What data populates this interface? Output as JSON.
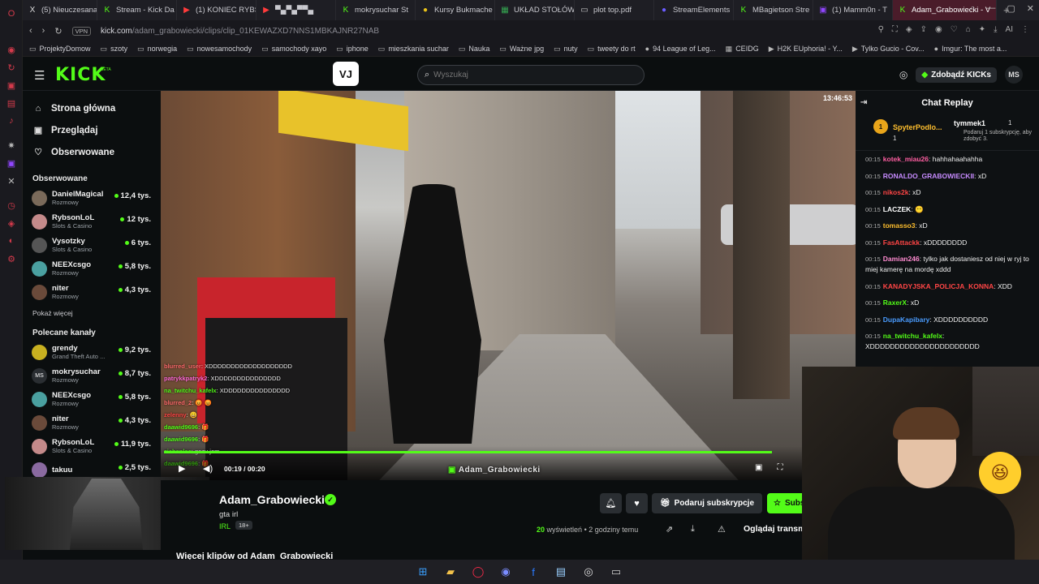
{
  "tabs": [
    {
      "label": "(5) Nieuczesana",
      "fav": "X",
      "color": "#ddd"
    },
    {
      "label": "Stream - Kick Da",
      "fav": "K",
      "color": "#53fc18"
    },
    {
      "label": "(1) KONIEC RYBS",
      "fav": "▶",
      "color": "#ff3b3b"
    },
    {
      "label": "▀▄▀▄▀▀▄",
      "fav": "▶",
      "color": "#ff3b3b"
    },
    {
      "label": "mokrysuchar St",
      "fav": "K",
      "color": "#53fc18"
    },
    {
      "label": "Kursy Bukmache",
      "fav": "●",
      "color": "#e9c21a"
    },
    {
      "label": "UKŁAD STOŁÓW",
      "fav": "▦",
      "color": "#36a852"
    },
    {
      "label": "plot top.pdf",
      "fav": "▭",
      "color": "#ccc"
    },
    {
      "label": "StreamElements",
      "fav": "●",
      "color": "#6a5cff"
    },
    {
      "label": "MBagietson Stre",
      "fav": "K",
      "color": "#53fc18"
    },
    {
      "label": "(1) Mamm0n - T",
      "fav": "▣",
      "color": "#9146ff"
    },
    {
      "label": "Adam_Grabowiecki - V",
      "fav": "K",
      "color": "#53fc18",
      "active": true
    }
  ],
  "browser": {
    "vpn": "VPN",
    "url_host": "kick.com",
    "url_path": "/adam_grabowiecki/clips/clip_01KEWAZXD7NNS1MBKAJNR27NAB"
  },
  "bookmarks": [
    {
      "label": "ProjektyDomow",
      "icon": "▭"
    },
    {
      "label": "szoty",
      "icon": "▭"
    },
    {
      "label": "norwegia",
      "icon": "▭"
    },
    {
      "label": "nowesamochody",
      "icon": "▭"
    },
    {
      "label": "samochody xayo",
      "icon": "▭"
    },
    {
      "label": "iphone",
      "icon": "▭"
    },
    {
      "label": "mieszkania suchar",
      "icon": "▭"
    },
    {
      "label": "Nauka",
      "icon": "▭"
    },
    {
      "label": "Ważne jpg",
      "icon": "▭"
    },
    {
      "label": "nuty",
      "icon": "▭"
    },
    {
      "label": "tweety do rt",
      "icon": "▭"
    },
    {
      "label": "94 League of Leg...",
      "icon": "●"
    },
    {
      "label": "CEIDG",
      "icon": "▦"
    },
    {
      "label": "H2K EUphoria! - Y...",
      "icon": "▶"
    },
    {
      "label": "Tylko Gucio - Cov...",
      "icon": "▶"
    },
    {
      "label": "Imgur: The most a...",
      "icon": "●"
    }
  ],
  "header": {
    "logo": "KICK",
    "beta": "BETA",
    "vj": "VJ",
    "search_placeholder": "Wyszukaj",
    "kicks_label": "Zdobądź KICKs",
    "avatar": "MS"
  },
  "nav": [
    {
      "label": "Strona główna",
      "icon": "⌂"
    },
    {
      "label": "Przeglądaj",
      "icon": "▣"
    },
    {
      "label": "Obserwowane",
      "icon": "♡"
    }
  ],
  "followed_heading": "Obserwowane",
  "followed": [
    {
      "name": "DanielMagical",
      "cat": "Rozmowy",
      "viewers": "12,4 tys.",
      "color": "#7a6a5a"
    },
    {
      "name": "RybsonLoL",
      "cat": "Slots & Casino",
      "viewers": "12 tys.",
      "color": "#c48a8a"
    },
    {
      "name": "Vysotzky",
      "cat": "Slots & Casino",
      "viewers": "6 tys.",
      "color": "#555"
    },
    {
      "name": "NEEXcsgo",
      "cat": "Rozmowy",
      "viewers": "5,8 tys.",
      "color": "#4aa0a0"
    },
    {
      "name": "niter",
      "cat": "Rozmowy",
      "viewers": "4,3 tys.",
      "color": "#6a4a3a"
    }
  ],
  "show_more": "Pokaż więcej",
  "recommended_heading": "Polecane kanały",
  "recommended": [
    {
      "name": "grendy",
      "cat": "Grand Theft Auto ...",
      "viewers": "9,2 tys.",
      "color": "#c8b020"
    },
    {
      "name": "mokrysuchar",
      "cat": "Rozmowy",
      "viewers": "8,7 tys.",
      "color": "#2a2e32",
      "initials": "MS"
    },
    {
      "name": "NEEXcsgo",
      "cat": "Rozmowy",
      "viewers": "5,8 tys.",
      "color": "#4aa0a0"
    },
    {
      "name": "niter",
      "cat": "Rozmowy",
      "viewers": "4,3 tys.",
      "color": "#6a4a3a"
    },
    {
      "name": "RybsonLoL",
      "cat": "Slots & Casino",
      "viewers": "11,9 tys.",
      "color": "#c48a8a"
    },
    {
      "name": "takuu",
      "cat": "",
      "viewers": "2,5 tys.",
      "color": "#8a6aa0"
    }
  ],
  "video": {
    "clock": "13:46:53",
    "time_current": "00:19",
    "time_sep": "/",
    "time_total": "00:20",
    "watermark": "Adam_Grabowiecki",
    "progress": 0.95,
    "overlay_chat": [
      {
        "user": "blurred_user",
        "text": ": XDDDDDDDDDDDDDDDDDDD"
      },
      {
        "user": "patrykkpatryk2",
        "text": ": XDDDDDDDDDDDDDDD"
      },
      {
        "user": "na_twitchu_kafelx",
        "text": ": XDDDDDDDDDDDDDDD"
      },
      {
        "user": "blurred_2",
        "text": ": 😡 😡"
      },
      {
        "user": "zelenny",
        "text": ": 😄"
      },
      {
        "user": "daawid9696",
        "text": ": 🎁"
      },
      {
        "user": "daawid9696",
        "text": ": 🎁"
      },
      {
        "user": "ziebanlec",
        "text": ": gazu jom"
      },
      {
        "user": "daawid9696",
        "text": ": 🎁"
      }
    ]
  },
  "channel": {
    "name": "Adam_Grabowiecki",
    "title": "gta irl",
    "category": "IRL",
    "age": "18+",
    "gift_label": "Podaruj subskrypcje",
    "sub_label": "Subskrybuj",
    "views_n": "20",
    "views_label": "wyświetleń",
    "time_ago": "• 2 godziny temu",
    "watch_label": "Oglądaj transmisję",
    "more_clips": "Więcej klipów od Adam_Grabowiecki"
  },
  "chat": {
    "title": "Chat Replay",
    "pin1_rank": "1",
    "pin1_name": "SpyterPodlo...",
    "pin1_count": "1",
    "pin2_name": "tymmek1",
    "pin2_count": "1",
    "pin2_desc": "Podaruj 1 subskrypcję, aby zdobyć 3.",
    "messages": [
      {
        "t": "00:15",
        "u": "kotek_miau26",
        "c": "#ff5fa2",
        "m": ": hahhahaahahha"
      },
      {
        "t": "00:15",
        "u": "RONALDO_GRABOWIECKII",
        "c": "#c78bff",
        "m": ": xD"
      },
      {
        "t": "00:15",
        "u": "nikos2k",
        "c": "#ff4545",
        "m": ": xD"
      },
      {
        "t": "00:15",
        "u": "LACZEK",
        "c": "#ffffff",
        "m": ": 😶"
      },
      {
        "t": "00:15",
        "u": "tomasso3",
        "c": "#ffbf2e",
        "m": ": xD"
      },
      {
        "t": "00:15",
        "u": "FasAttackk",
        "c": "#ff4545",
        "m": ": xDDDDDDDD"
      },
      {
        "t": "00:15",
        "u": "Damian246",
        "c": "#ff8bd0",
        "m": ": tylko jak dostaniesz od niej w ryj to miej kamerę na mordę xddd"
      },
      {
        "t": "00:15",
        "u": "KANADYJSKA_POLICJA_KONNA",
        "c": "#ff4545",
        "m": ": XDD"
      },
      {
        "t": "00:15",
        "u": "RaxerX",
        "c": "#53fc18",
        "m": ": xD"
      },
      {
        "t": "00:15",
        "u": "DupaKapibary",
        "c": "#4a9cff",
        "m": ": XDDDDDDDDDD"
      },
      {
        "t": "00:15",
        "u": "na_twitchu_kafelx",
        "c": "#53fc18",
        "m": ": XDDDDDDDDDDDDDDDDDDDDDD"
      }
    ]
  },
  "colors": {
    "kick_green": "#53fc18",
    "bg": "#0b0e0f"
  },
  "taskbar": [
    {
      "icon": "windows-icon",
      "glyph": "⊞",
      "color": "#3aa0ff"
    },
    {
      "icon": "folder-icon",
      "glyph": "▰",
      "color": "#f3c24a"
    },
    {
      "icon": "opera-icon",
      "glyph": "◯",
      "color": "#ff2a4a"
    },
    {
      "icon": "discord-icon",
      "glyph": "◉",
      "color": "#7a8cff"
    },
    {
      "icon": "facebook-icon",
      "glyph": "f",
      "color": "#2a7bff"
    },
    {
      "icon": "notepad-icon",
      "glyph": "▤",
      "color": "#9ad0ff"
    },
    {
      "icon": "obs-icon",
      "glyph": "◎",
      "color": "#ddd"
    },
    {
      "icon": "terminal-icon",
      "glyph": "▭",
      "color": "#ccc"
    }
  ]
}
